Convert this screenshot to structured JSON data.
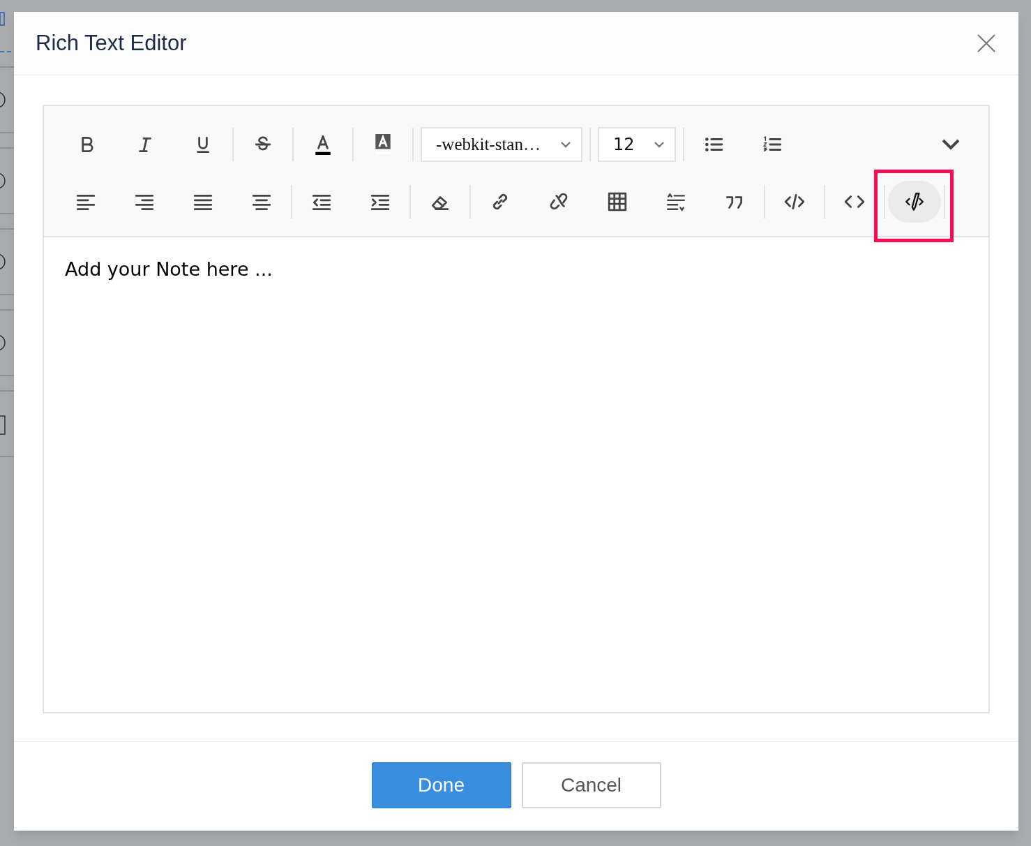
{
  "dialog": {
    "title": "Rich Text Editor"
  },
  "toolbar": {
    "rows": [
      {
        "groups": [
          [
            {
              "kind": "button",
              "selected": false,
              "annotated": false
            },
            {
              "kind": "button",
              "selected": false,
              "annotated": false
            },
            {
              "kind": "button",
              "selected": false,
              "annotated": false
            }
          ],
          [
            {
              "kind": "button",
              "selected": false,
              "annotated": false
            }
          ],
          [
            {
              "kind": "button",
              "selected": false,
              "annotated": false
            }
          ],
          [
            {
              "kind": "button",
              "selected": false,
              "annotated": false
            }
          ],
          [
            {
              "kind": "dropdown",
              "value": "-webkit-stan…"
            }
          ],
          [
            {
              "kind": "dropdown",
              "value": "12"
            }
          ],
          [
            {
              "kind": "button",
              "selected": false,
              "annotated": false
            },
            {
              "kind": "button",
              "selected": false,
              "annotated": false
            }
          ]
        ],
        "expand": {
          "expanded": false
        }
      },
      {
        "groups": [
          [
            {
              "kind": "button",
              "selected": false,
              "annotated": false
            },
            {
              "kind": "button",
              "selected": false,
              "annotated": false
            },
            {
              "kind": "button",
              "selected": false,
              "annotated": false
            },
            {
              "kind": "button",
              "selected": false,
              "annotated": false
            }
          ],
          [
            {
              "kind": "button",
              "selected": false,
              "annotated": false
            },
            {
              "kind": "button",
              "selected": false,
              "annotated": false
            }
          ],
          [
            {
              "kind": "button",
              "selected": false,
              "annotated": false
            }
          ],
          [
            {
              "kind": "button",
              "selected": false,
              "annotated": false
            },
            {
              "kind": "button",
              "selected": false,
              "annotated": false
            },
            {
              "kind": "button",
              "selected": false,
              "annotated": false
            },
            {
              "kind": "button",
              "selected": false,
              "annotated": false
            },
            {
              "kind": "button",
              "selected": false,
              "annotated": false
            }
          ],
          [
            {
              "kind": "button",
              "selected": false,
              "annotated": false
            }
          ],
          [
            {
              "kind": "button",
              "selected": false,
              "annotated": false
            }
          ],
          [
            {
              "kind": "button",
              "selected": true,
              "annotated": true
            }
          ]
        ]
      }
    ]
  },
  "editor": {
    "placeholder": "Add your Note here ..."
  },
  "buttons": [
    {
      "label": "Done",
      "kind": "primary"
    },
    {
      "label": "Cancel",
      "kind": "secondary"
    }
  ]
}
